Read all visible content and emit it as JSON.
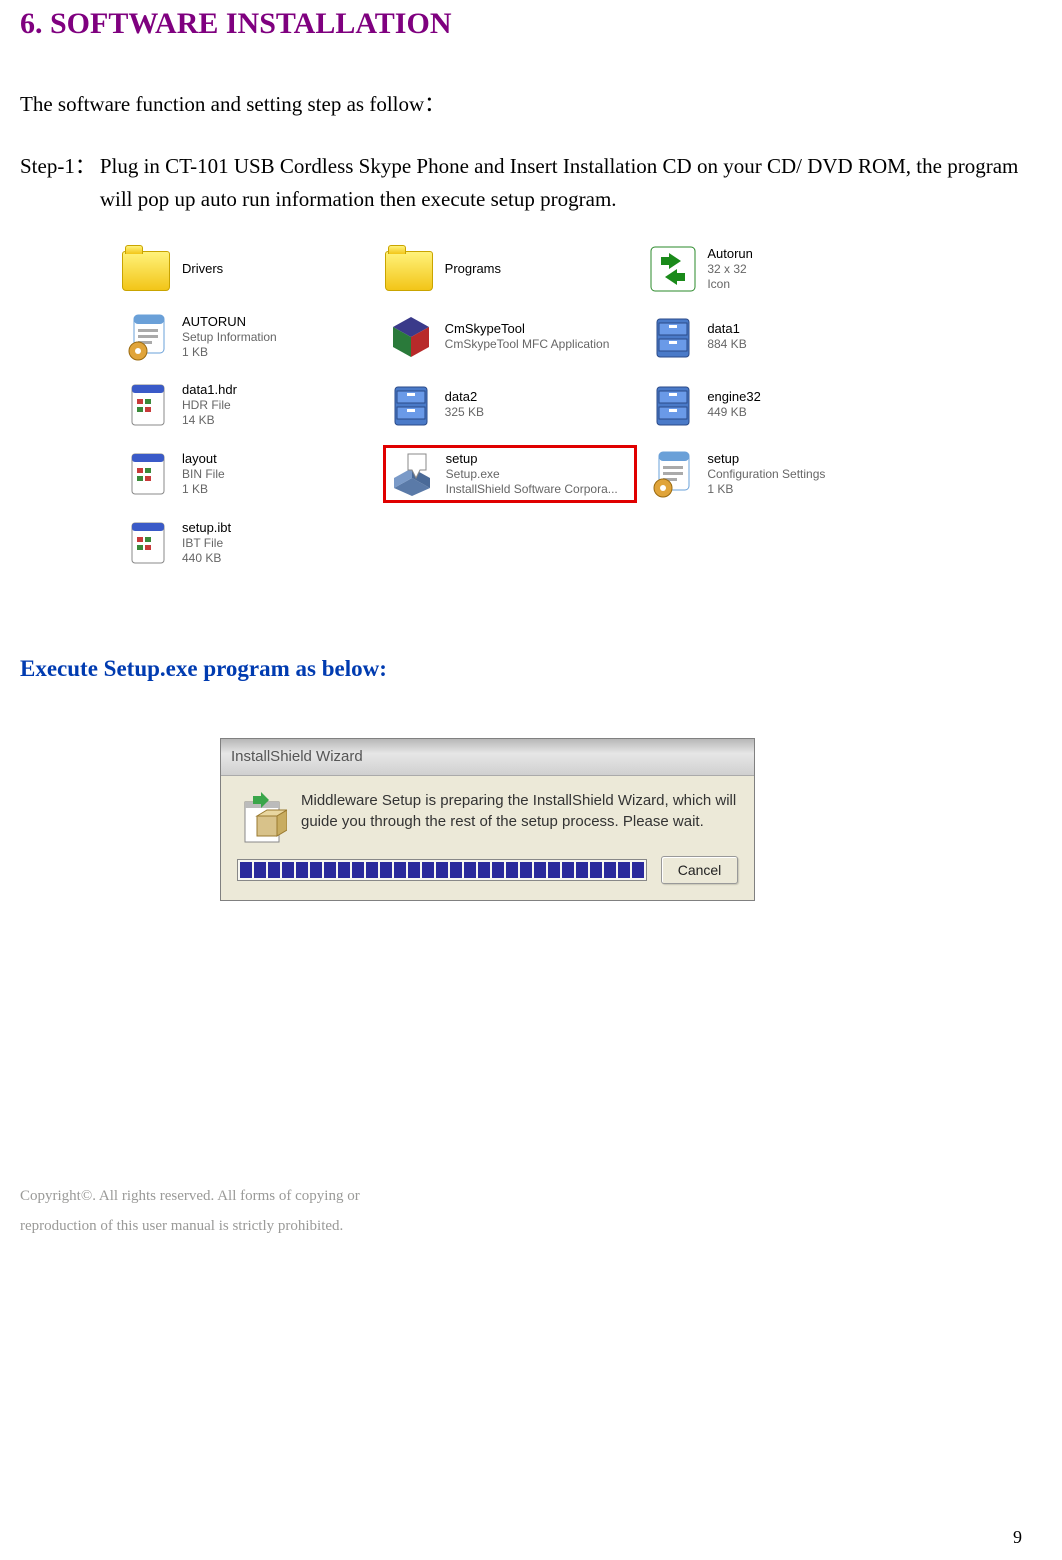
{
  "heading": "6. SOFTWARE INSTALLATION",
  "intro": "The software function and setting step as follow：",
  "step": {
    "label": "Step-1：",
    "text": "Plug in CT-101 USB Cordless Skype Phone and Insert Installation CD on your CD/ DVD ROM, the program will pop up auto run information then execute setup program."
  },
  "files": [
    {
      "type": "folder",
      "name": "Drivers",
      "desc": ""
    },
    {
      "type": "folder",
      "name": "Programs",
      "desc": ""
    },
    {
      "type": "autorun",
      "name": "Autorun",
      "desc": "32 x 32\nIcon"
    },
    {
      "type": "config",
      "name": "AUTORUN",
      "desc": "Setup Information\n1 KB"
    },
    {
      "type": "cabinet-cube",
      "name": "CmSkypeTool",
      "desc": "CmSkypeTool MFC Application"
    },
    {
      "type": "cabinet",
      "name": "data1",
      "desc": "884 KB"
    },
    {
      "type": "generic",
      "name": "data1.hdr",
      "desc": "HDR File\n14 KB"
    },
    {
      "type": "cabinet",
      "name": "data2",
      "desc": "325 KB"
    },
    {
      "type": "cabinet",
      "name": "engine32",
      "desc": "449 KB"
    },
    {
      "type": "generic",
      "name": "layout",
      "desc": "BIN File\n1 KB"
    },
    {
      "type": "setup",
      "name": "setup",
      "desc": "Setup.exe\nInstallShield Software Corpora...",
      "highlight": true
    },
    {
      "type": "config",
      "name": "setup",
      "desc": "Configuration Settings\n1 KB"
    },
    {
      "type": "generic",
      "name": "setup.ibt",
      "desc": "IBT File\n440 KB"
    }
  ],
  "subheading": "Execute Setup.exe program as below:",
  "wizard": {
    "title": "InstallShield Wizard",
    "body": "Middleware Setup is preparing the InstallShield Wizard, which will guide you through the rest of the setup process. Please wait.",
    "progress_blocks": 29,
    "cancel_label": "Cancel"
  },
  "footer": {
    "line1": "Copyright©. All rights reserved. All forms of copying or",
    "line2": "reproduction of this user manual is strictly prohibited."
  },
  "page_number": "9"
}
